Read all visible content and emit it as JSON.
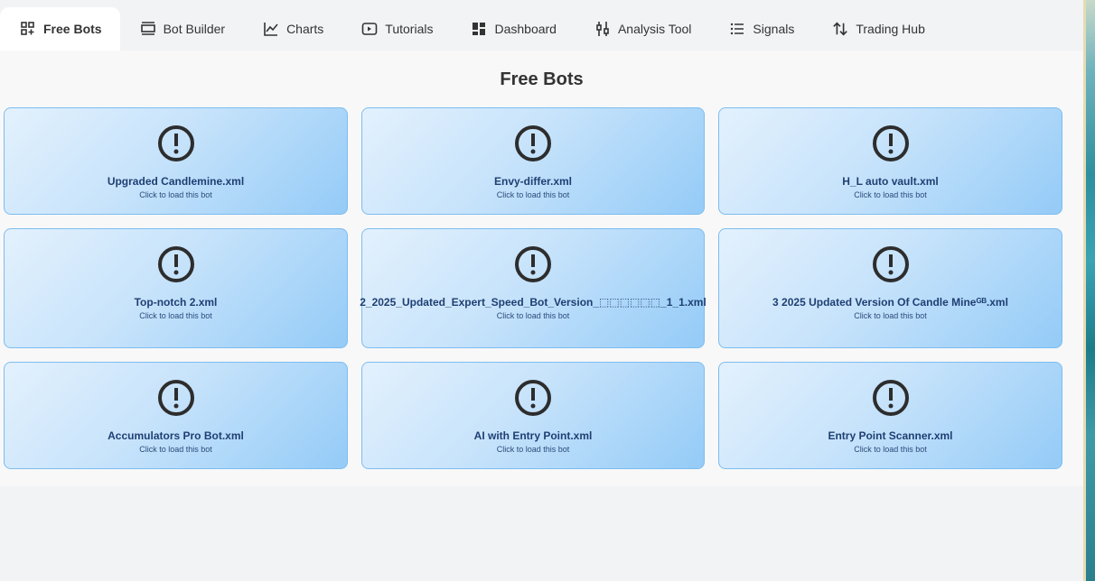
{
  "tabs": [
    {
      "label": "Free Bots",
      "icon": "grid-plus-icon",
      "active": true
    },
    {
      "label": "Bot Builder",
      "icon": "builder-icon",
      "active": false
    },
    {
      "label": "Charts",
      "icon": "chart-line-icon",
      "active": false
    },
    {
      "label": "Tutorials",
      "icon": "play-icon",
      "active": false
    },
    {
      "label": "Dashboard",
      "icon": "dashboard-icon",
      "active": false
    },
    {
      "label": "Analysis Tool",
      "icon": "sliders-icon",
      "active": false
    },
    {
      "label": "Signals",
      "icon": "list-icon",
      "active": false
    },
    {
      "label": "Trading Hub",
      "icon": "arrows-updown-icon",
      "active": false
    }
  ],
  "page": {
    "title": "Free Bots"
  },
  "bots": [
    {
      "name": "Upgraded Candlemine.xml",
      "hint": "Click to load this bot"
    },
    {
      "name": "Envy-differ.xml",
      "hint": "Click to load this bot"
    },
    {
      "name": "H_L auto vault.xml",
      "hint": "Click to load this bot"
    },
    {
      "name": "Top-notch 2.xml",
      "hint": "Click to load this bot"
    },
    {
      "name": "2_2025_Updated_Expert_Speed_Bot_Version_⬚⬚⬚⬚⬚⬚_1_1.xml",
      "hint": "Click to load this bot"
    },
    {
      "name": "3 2025 Updated Version Of Candle Mineᴳᴮ.xml",
      "hint": "Click to load this bot"
    },
    {
      "name": "Accumulators Pro Bot.xml",
      "hint": "Click to load this bot"
    },
    {
      "name": "AI with Entry Point.xml",
      "hint": "Click to load this bot"
    },
    {
      "name": "Entry Point Scanner.xml",
      "hint": "Click to load this bot"
    }
  ],
  "colors": {
    "card_border": "#7cbdf0",
    "card_title": "#1f3f73",
    "active_tab": "#ffffff"
  }
}
